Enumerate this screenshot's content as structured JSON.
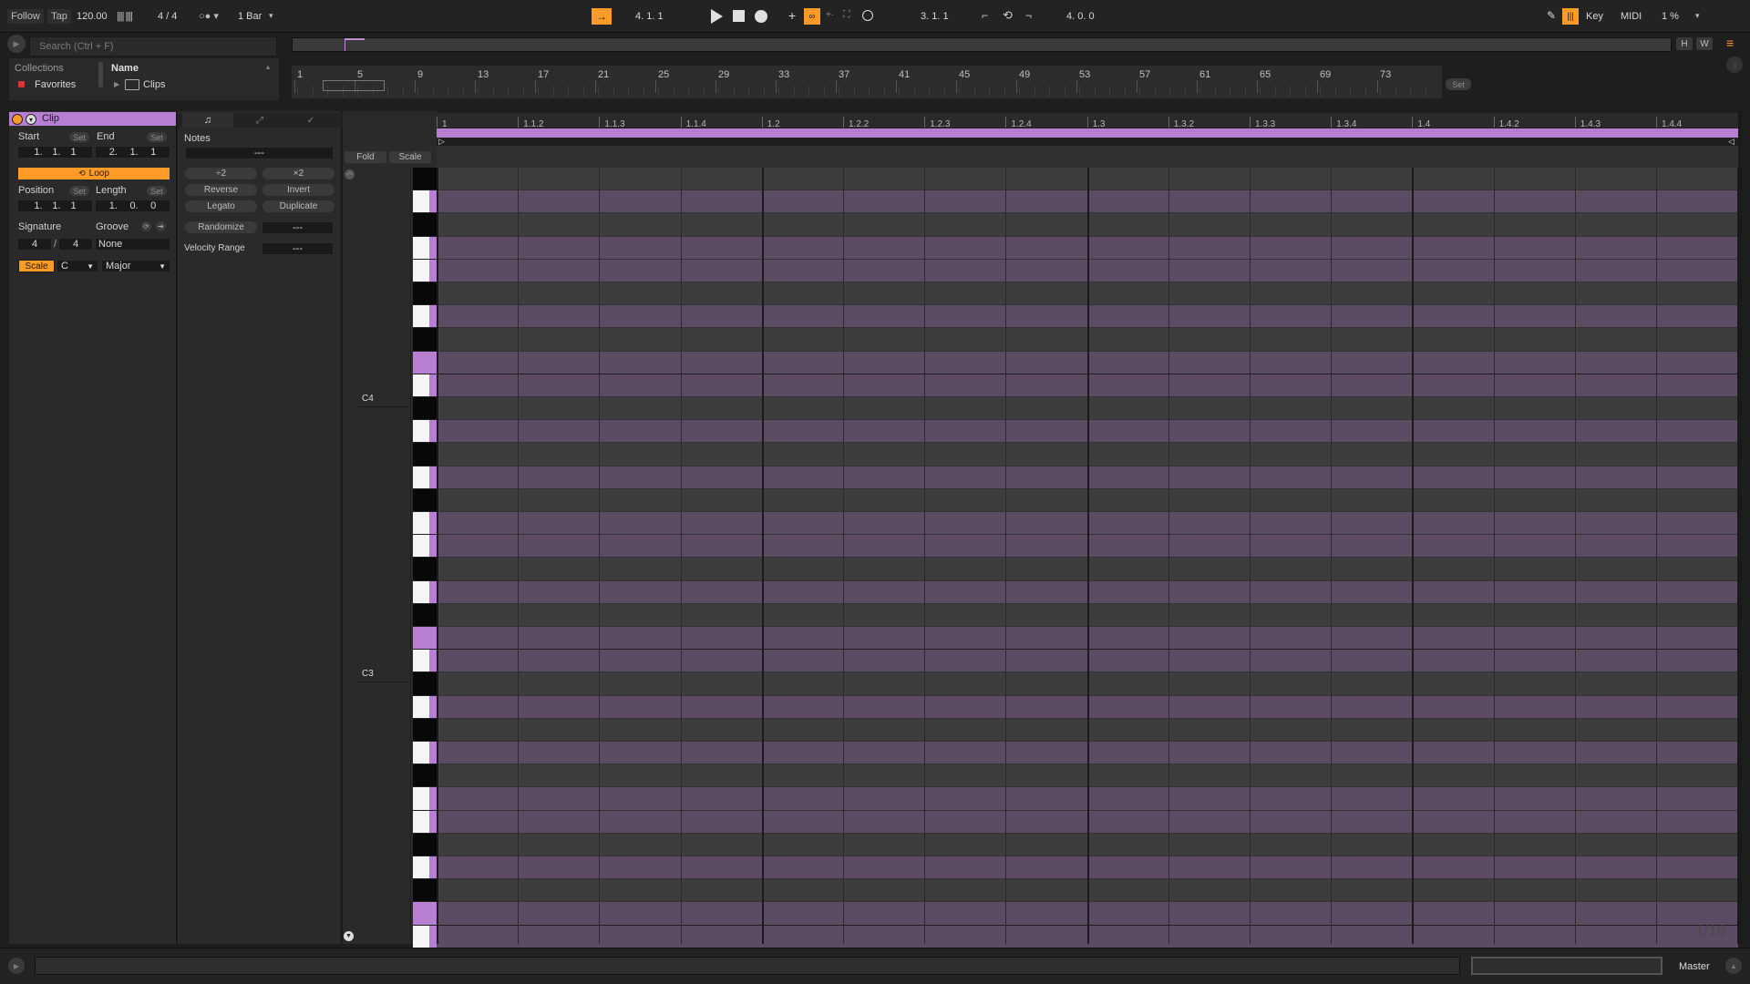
{
  "transport": {
    "follow": "Follow",
    "tap": "Tap",
    "tempo": "120.00",
    "signature": "4 / 4",
    "quantize": "1 Bar",
    "position": "4.   1.   1",
    "loop_start": "3.   1.   1",
    "loop_length": "4.   0.   0",
    "key_label": "Key",
    "midi_label": "MIDI",
    "cpu": "1 %"
  },
  "browser": {
    "search_placeholder": "Search (Ctrl + F)",
    "collections_label": "Collections",
    "favorites_label": "Favorites",
    "name_header": "Name",
    "clips_folder": "Clips"
  },
  "arrangement": {
    "bar_numbers": [
      "1",
      "5",
      "9",
      "13",
      "17",
      "21",
      "25",
      "29",
      "33",
      "37",
      "41",
      "45",
      "49",
      "53",
      "57",
      "61",
      "65",
      "69",
      "73"
    ],
    "set_label": "Set",
    "h_label": "H",
    "w_label": "W"
  },
  "clip": {
    "title": "Clip",
    "start_label": "Start",
    "end_label": "End",
    "set_label": "Set",
    "start_value": [
      "1.",
      "1.",
      "1"
    ],
    "end_value": [
      "2.",
      "1.",
      "1"
    ],
    "loop_label": "Loop",
    "position_label": "Position",
    "length_label": "Length",
    "position_value": [
      "1.",
      "1.",
      "1"
    ],
    "length_value": [
      "1.",
      "0.",
      "0"
    ],
    "signature_label": "Signature",
    "groove_label": "Groove",
    "sig_num": "4",
    "sig_sep": "/",
    "sig_den": "4",
    "groove_value": "None",
    "scale_label": "Scale",
    "scale_root": "C",
    "scale_mode": "Major"
  },
  "notes": {
    "title": "Notes",
    "pitch_value": "---",
    "div2": "÷2",
    "mul2": "×2",
    "reverse": "Reverse",
    "invert": "Invert",
    "legato": "Legato",
    "duplicate": "Duplicate",
    "randomize": "Randomize",
    "randomize_value": "---",
    "velocity_range_label": "Velocity Range",
    "velocity_range_value": "---"
  },
  "editor": {
    "fold": "Fold",
    "scale": "Scale",
    "beat_labels": [
      "1",
      "1.1.2",
      "1.1.3",
      "1.1.4",
      "1.2",
      "1.2.2",
      "1.2.3",
      "1.2.4",
      "1.3",
      "1.3.2",
      "1.3.3",
      "1.3.4",
      "1.4",
      "1.4.2",
      "1.4.3",
      "1.4.4"
    ],
    "note_c4": "C4",
    "note_c3": "C3",
    "grid_label": "1/16"
  },
  "status": {
    "master_label": "Master"
  },
  "colors": {
    "accent": "#ff9b26",
    "clip_purple": "#b77fd1",
    "lane_in_scale": "#5c4b62",
    "lane_out_scale": "#3d3d3d"
  }
}
